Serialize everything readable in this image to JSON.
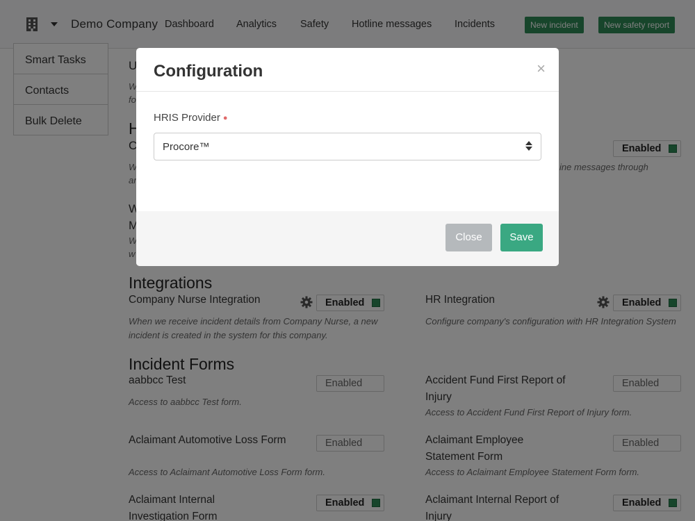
{
  "nav": {
    "company": "Demo Company",
    "links": [
      "Dashboard",
      "Analytics",
      "Safety",
      "Hotline messages",
      "Incidents"
    ],
    "new_incident": "New incident",
    "new_safety_report": "New safety report",
    "icons": {
      "company": "building-icon",
      "dropdown": "caret-down-icon"
    }
  },
  "sidebar": {
    "items": [
      "Smart Tasks",
      "Contacts",
      "Bulk Delete"
    ]
  },
  "main": {
    "partial": {
      "u_title": "U",
      "u_desc1": "W",
      "u_desc2": "fo",
      "h_section": "H",
      "c_title": "C",
      "c_desc1": "W",
      "c_desc2": "ar",
      "right_desc": "ine messages through",
      "w_title": "W",
      "m_title": "M",
      "w_desc1": "W",
      "w_desc2": "w"
    },
    "toggle_label": "Enabled",
    "integrations": {
      "title": "Integrations",
      "items": [
        {
          "name": "Company Nurse Integration",
          "desc": "When we receive incident details from Company Nurse, a new incident is created in the system for this company.",
          "status": "Enabled",
          "enabled": true
        },
        {
          "name": "HR Integration",
          "desc": "Configure company's configuration with HR Integration System",
          "status": "Enabled",
          "enabled": true
        }
      ]
    },
    "incident_forms": {
      "title": "Incident Forms",
      "items": [
        {
          "name": "aabbcc Test",
          "desc": "Access to aabbcc Test form.",
          "status": "Enabled",
          "enabled": false
        },
        {
          "name": "Accident Fund First Report of Injury",
          "desc": "Access to Accident Fund First Report of Injury form.",
          "status": "Enabled",
          "enabled": false
        },
        {
          "name": "Aclaimant Automotive Loss Form",
          "desc": "Access to Aclaimant Automotive Loss Form form.",
          "status": "Enabled",
          "enabled": false
        },
        {
          "name": "Aclaimant Employee Statement Form",
          "desc": "Access to Aclaimant Employee Statement Form form.",
          "status": "Enabled",
          "enabled": false
        },
        {
          "name": "Aclaimant Internal Investigation Form",
          "status": "Enabled",
          "enabled": true
        },
        {
          "name": "Aclaimant Internal Report of Injury",
          "status": "Enabled",
          "enabled": true
        }
      ]
    }
  },
  "modal": {
    "title": "Configuration",
    "close_symbol": "×",
    "field_label": "HRIS Provider",
    "required_mark": "●",
    "selected": "Procore™",
    "close_button": "Close",
    "save_button": "Save"
  },
  "colors": {
    "accent_green": "#2e8b57",
    "save_green": "#3aa882",
    "close_gray": "#b5b9bc",
    "overlay": "rgba(0,0,0,0.5)"
  }
}
